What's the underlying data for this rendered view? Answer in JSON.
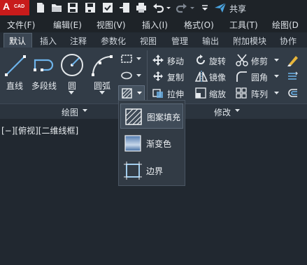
{
  "app": {
    "logo_main": "A",
    "logo_sub": "CAD",
    "share_label": "共享"
  },
  "menu": [
    "文件(F)",
    "编辑(E)",
    "视图(V)",
    "插入(I)",
    "格式(O)",
    "工具(T)",
    "绘图(D"
  ],
  "ribbon_tabs": [
    "默认",
    "插入",
    "注释",
    "参数化",
    "视图",
    "管理",
    "输出",
    "附加模块",
    "协作"
  ],
  "draw_panel": {
    "title": "绘图",
    "tools": {
      "line": "直线",
      "polyline": "多段线",
      "circle": "圆",
      "arc": "圆弧"
    }
  },
  "modify_panel": {
    "title": "修改",
    "tools": {
      "move": "移动",
      "rotate": "旋转",
      "trim": "修剪",
      "copy": "复制",
      "mirror": "镜像",
      "fillet": "圆角",
      "stretch": "拉伸",
      "scale": "缩放",
      "array": "阵列"
    }
  },
  "viewport_label": "[−][俯视][二维线框]",
  "hatch_flyout": {
    "items": [
      {
        "label": "图案填充",
        "icon": "hatch-icon",
        "selected": true
      },
      {
        "label": "渐变色",
        "icon": "gradient-icon",
        "selected": false
      },
      {
        "label": "边界",
        "icon": "boundary-icon",
        "selected": false
      }
    ]
  },
  "colors": {
    "accent_blue": "#5aa9e6",
    "logo_red": "#c81b1b",
    "background": "#212830"
  }
}
